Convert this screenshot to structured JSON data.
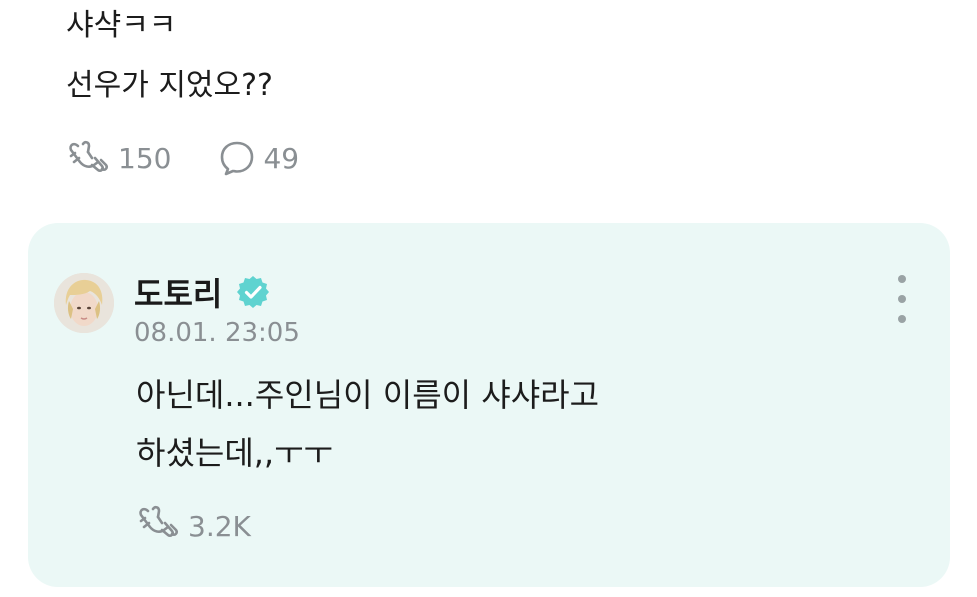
{
  "post": {
    "lines": [
      "샤샥ㅋㅋ",
      "선우가 지었오??"
    ],
    "likes_count": "150",
    "comments_count": "49"
  },
  "reply": {
    "author_name": "도토리",
    "timestamp": "08.01. 23:05",
    "lines": [
      "아닌데...주인님이 이름이 샤샤라고",
      "하셨는데,,ㅜㅜ"
    ],
    "likes_count": "3.2K"
  },
  "colors": {
    "card_background": "#ebf8f6",
    "muted_text": "#8a8f93",
    "verified_badge": "#5fd3d0"
  },
  "icons": {
    "like": "heart-hands-like-icon",
    "comment": "speech-bubble-icon",
    "verified": "verified-badge-icon",
    "more": "more-vertical-icon"
  }
}
